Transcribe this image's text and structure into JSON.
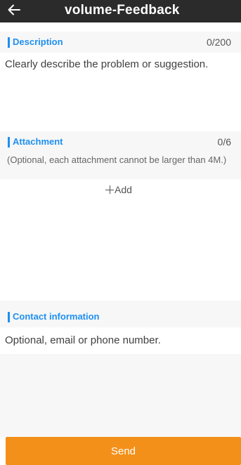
{
  "header": {
    "back_icon": "arrow-left-icon",
    "title": "volume-Feedback"
  },
  "description": {
    "label": "Description",
    "count": "0/200",
    "value": "",
    "placeholder": "Clearly describe the problem or suggestion."
  },
  "attachment": {
    "label": "Attachment",
    "count": "0/6",
    "note": "(Optional, each attachment cannot be larger than 4M.)",
    "add_icon": "plus-icon",
    "add_label": "Add"
  },
  "contact": {
    "label": "Contact information",
    "value": "",
    "placeholder": "Optional, email or phone number."
  },
  "footer": {
    "send_label": "Send"
  },
  "colors": {
    "header_bg": "#2b2b2b",
    "accent_blue": "#1e8ff0",
    "send_orange": "#f39019",
    "section_bg": "#f7f7f7"
  }
}
